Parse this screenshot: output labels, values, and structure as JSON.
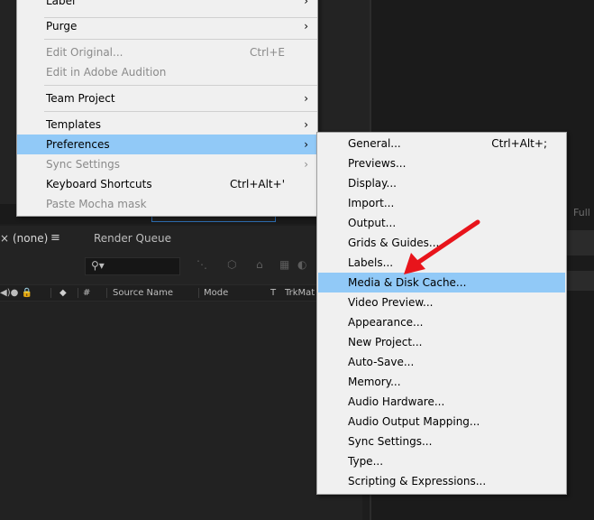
{
  "background": {
    "right_toolbar_label": "Full",
    "timeline": {
      "tab_close": "×",
      "tab_label": "(none)",
      "tab_menu": "≡",
      "render_queue_tab": "Render Queue",
      "search_icon": "⚲▾",
      "columns": [
        "#",
        "Source Name",
        "Mode",
        "T",
        "TrkMat"
      ]
    }
  },
  "main_menu": {
    "items": [
      {
        "label": "Label",
        "shortcut": "",
        "arrow": "›",
        "disabled": false
      },
      {
        "label": "Purge",
        "shortcut": "",
        "arrow": "›",
        "disabled": false
      },
      {
        "label": "Edit Original...",
        "shortcut": "Ctrl+E",
        "arrow": "",
        "disabled": true
      },
      {
        "label": "Edit in Adobe Audition",
        "shortcut": "",
        "arrow": "",
        "disabled": true
      },
      {
        "label": "Team Project",
        "shortcut": "",
        "arrow": "›",
        "disabled": false
      },
      {
        "label": "Templates",
        "shortcut": "",
        "arrow": "›",
        "disabled": false
      },
      {
        "label": "Preferences",
        "shortcut": "",
        "arrow": "›",
        "disabled": false
      },
      {
        "label": "Sync Settings",
        "shortcut": "",
        "arrow": "›",
        "disabled": true
      },
      {
        "label": "Keyboard Shortcuts",
        "shortcut": "Ctrl+Alt+'",
        "arrow": "",
        "disabled": false
      },
      {
        "label": "Paste Mocha mask",
        "shortcut": "",
        "arrow": "",
        "disabled": true
      }
    ]
  },
  "preferences_submenu": {
    "items": [
      {
        "label": "General...",
        "shortcut": "Ctrl+Alt+;"
      },
      {
        "label": "Previews...",
        "shortcut": ""
      },
      {
        "label": "Display...",
        "shortcut": ""
      },
      {
        "label": "Import...",
        "shortcut": ""
      },
      {
        "label": "Output...",
        "shortcut": ""
      },
      {
        "label": "Grids & Guides...",
        "shortcut": ""
      },
      {
        "label": "Labels...",
        "shortcut": ""
      },
      {
        "label": "Media & Disk Cache...",
        "shortcut": ""
      },
      {
        "label": "Video Preview...",
        "shortcut": ""
      },
      {
        "label": "Appearance...",
        "shortcut": ""
      },
      {
        "label": "New Project...",
        "shortcut": ""
      },
      {
        "label": "Auto-Save...",
        "shortcut": ""
      },
      {
        "label": "Memory...",
        "shortcut": ""
      },
      {
        "label": "Audio Hardware...",
        "shortcut": ""
      },
      {
        "label": "Audio Output Mapping...",
        "shortcut": ""
      },
      {
        "label": "Sync Settings...",
        "shortcut": ""
      },
      {
        "label": "Type...",
        "shortcut": ""
      },
      {
        "label": "Scripting & Expressions...",
        "shortcut": ""
      }
    ]
  },
  "colors": {
    "menu_highlight": "#91c9f7",
    "annotation_arrow": "#e8141b"
  }
}
